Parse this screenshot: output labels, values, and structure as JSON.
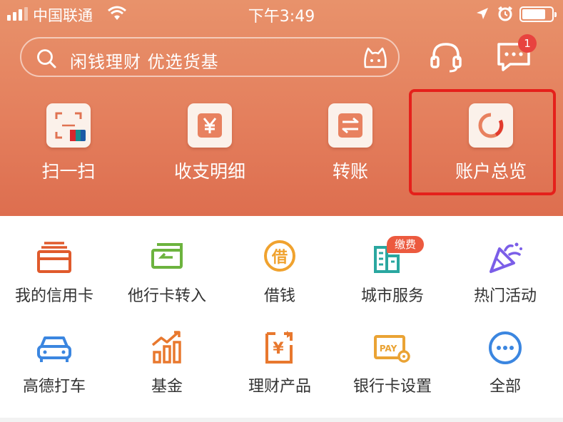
{
  "status_bar": {
    "carrier": "中国联通",
    "time": "下午3:49"
  },
  "search": {
    "placeholder": "闲钱理财 优选货基"
  },
  "message_badge": "1",
  "quick_actions": [
    {
      "label": "扫一扫",
      "icon": "scan-icon"
    },
    {
      "label": "收支明细",
      "icon": "yen-icon"
    },
    {
      "label": "转账",
      "icon": "transfer-icon"
    },
    {
      "label": "账户总览",
      "icon": "ring-icon"
    }
  ],
  "services_row1": [
    {
      "label": "我的信用卡",
      "icon": "credit-card-icon"
    },
    {
      "label": "他行卡转入",
      "icon": "card-transfer-icon"
    },
    {
      "label": "借钱",
      "icon": "borrow-icon"
    },
    {
      "label": "城市服务",
      "icon": "city-icon",
      "badge": "缴费"
    },
    {
      "label": "热门活动",
      "icon": "party-icon"
    }
  ],
  "services_row2": [
    {
      "label": "高德打车",
      "icon": "car-icon"
    },
    {
      "label": "基金",
      "icon": "fund-chart-icon"
    },
    {
      "label": "理财产品",
      "icon": "wealth-icon"
    },
    {
      "label": "银行卡设置",
      "icon": "pay-card-icon"
    },
    {
      "label": "全部",
      "icon": "more-icon"
    }
  ],
  "colors": {
    "header": "#e47f5d",
    "highlight_border": "#e5201b",
    "badge": "#e8433f"
  }
}
